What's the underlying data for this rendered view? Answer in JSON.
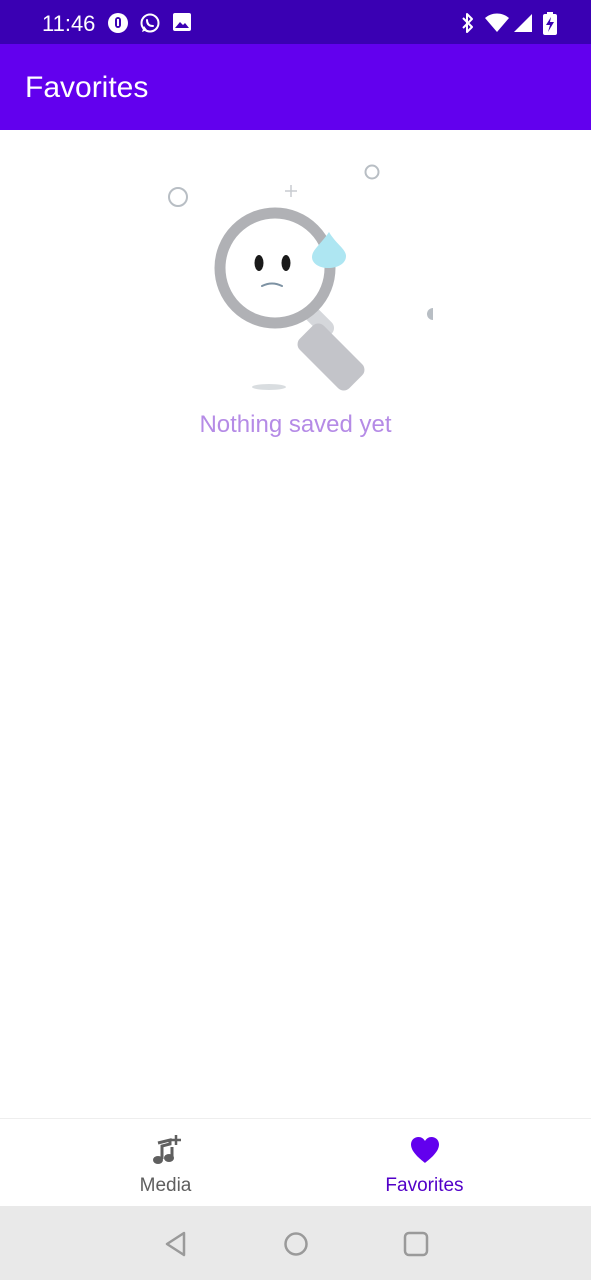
{
  "status_bar": {
    "time": "11:46",
    "left_icons": [
      "pocket-casts-icon",
      "whatsapp-icon",
      "image-icon"
    ],
    "right_icons": [
      "bluetooth-icon",
      "wifi-icon",
      "signal-icon",
      "battery-charging-icon"
    ]
  },
  "app_bar": {
    "title": "Favorites"
  },
  "empty_state": {
    "illustration": "sad-magnifier-icon",
    "message": "Nothing saved yet"
  },
  "bottom_nav": {
    "items": [
      {
        "label": "Media",
        "icon": "music-add-icon",
        "selected": false
      },
      {
        "label": "Favorites",
        "icon": "heart-icon",
        "selected": true
      }
    ]
  },
  "system_nav": {
    "buttons": [
      "back-icon",
      "home-icon",
      "recents-icon"
    ]
  },
  "colors": {
    "status_bar": "#3a00b3",
    "app_bar": "#6200ee",
    "accent": "#6200ee",
    "empty_text": "#b58be6",
    "inactive_nav": "#5f5f5f",
    "system_nav": "#e9e9e9"
  }
}
